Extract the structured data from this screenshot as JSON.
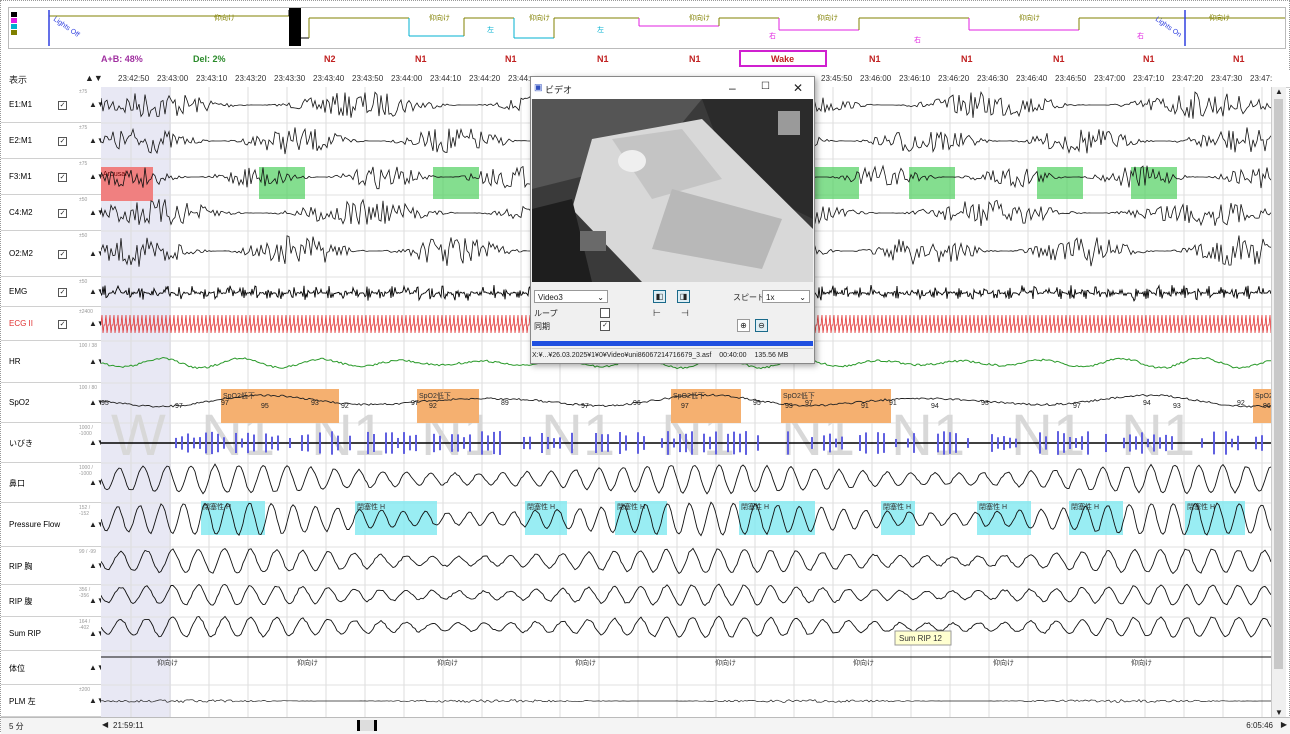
{
  "hypnogram": {
    "legend_colors": [
      "#000000",
      "#e020e0",
      "#00b0d0",
      "#808000"
    ],
    "labels_upper": [
      "仰向け",
      "仰向け",
      "仰向け",
      "仰向け",
      "仰向け",
      "仰向け",
      "仰向け"
    ],
    "lights_off": "Lights Off",
    "lights_on": "Lights On",
    "labels_side": [
      "左",
      "左",
      "右",
      "右",
      "右"
    ]
  },
  "stage_bar": {
    "ab": "A+B: 48%",
    "del": "Del: 2%",
    "stages": [
      "N2",
      "N1",
      "N1",
      "N1",
      "N1",
      "Wake",
      "N1",
      "N1",
      "N1",
      "N1",
      "N1"
    ]
  },
  "time_bar": {
    "display_label": "表示",
    "ticks": [
      "23:42:50",
      "23:43:00",
      "23:43:10",
      "23:43:20",
      "23:43:30",
      "23:43:40",
      "23:43:50",
      "23:44:00",
      "23:44:10",
      "23:44:20",
      "23:44:",
      "23:45:50",
      "23:46:00",
      "23:46:10",
      "23:46:20",
      "23:46:30",
      "23:46:40",
      "23:46:50",
      "23:47:00",
      "23:47:10",
      "23:47:20",
      "23:47:30",
      "23:47:"
    ]
  },
  "channels": [
    {
      "name": "E1:M1",
      "checked": true,
      "mini": "±75",
      "color": "#000000"
    },
    {
      "name": "E2:M1",
      "checked": true,
      "mini": "±75",
      "color": "#000000"
    },
    {
      "name": "F3:M1",
      "checked": true,
      "mini": "±75",
      "color": "#000000"
    },
    {
      "name": "C4:M2",
      "checked": true,
      "mini": "±50",
      "color": "#000000"
    },
    {
      "name": "O2:M2",
      "checked": true,
      "mini": "±50",
      "color": "#000000"
    },
    {
      "name": "EMG",
      "checked": true,
      "mini": "±50",
      "color": "#000000"
    },
    {
      "name": "ECG II",
      "checked": true,
      "mini": "±2400",
      "color": "#e03030"
    },
    {
      "name": "HR",
      "checked": false,
      "mini": "100 / 38",
      "color": "#000000"
    },
    {
      "name": "SpO2",
      "checked": false,
      "mini": "100 / 80",
      "color": "#000000"
    },
    {
      "name": "いびき",
      "checked": false,
      "mini": "1000 / -1000",
      "color": "#000000"
    },
    {
      "name": "鼻口",
      "checked": false,
      "mini": "1000 / -1000",
      "color": "#000000"
    },
    {
      "name": "Pressure Flow",
      "checked": false,
      "mini": "152 / -152",
      "color": "#000000"
    },
    {
      "name": "RIP 胸",
      "checked": false,
      "mini": "99 / -99",
      "color": "#000000"
    },
    {
      "name": "RIP 腹",
      "checked": false,
      "mini": "356 / -356",
      "color": "#000000"
    },
    {
      "name": "Sum RIP",
      "checked": false,
      "mini": "164 / -402",
      "color": "#000000"
    },
    {
      "name": "体位",
      "checked": false,
      "mini": "",
      "color": "#000000"
    },
    {
      "name": "PLM 左",
      "checked": false,
      "mini": "±200",
      "color": "#000000"
    }
  ],
  "events": {
    "arousal": "Arousal",
    "spo2_drop": "SpO2低下",
    "obstructive": "閉塞性 H",
    "sum_rip_tag": "Sum RIP  12",
    "position": "仰向け",
    "spo2_values": [
      "95",
      "97",
      "97",
      "95",
      "93",
      "92",
      "97",
      "92",
      "89",
      "97",
      "96",
      "97",
      "95",
      "93",
      "97",
      "91",
      "91",
      "94",
      "93",
      "97",
      "94",
      "93",
      "92",
      "96"
    ],
    "bg_stage_letters": [
      "W",
      "N1",
      "N1",
      "N1",
      "N1",
      "N1",
      "N1",
      "N1",
      "N1",
      "N1"
    ]
  },
  "video_window": {
    "title": "ビデオ",
    "source": "Video3",
    "speed_label": "スピード",
    "speed_value": "1x",
    "loop_label": "ループ",
    "sync_label": "同期",
    "loop_checked": false,
    "sync_checked": true,
    "status_path": "X:¥...¥26.03.2025¥1¥0¥Video¥uni86067214716679_3.asf",
    "status_time": "00:40:00",
    "status_size": "135.56 MB"
  },
  "bottom_bar": {
    "zoom": "5 分",
    "start": "21:59:11",
    "end": "6:05:46"
  },
  "colors": {
    "arousal_fill": "#f08080",
    "spindle_fill": "#50d060",
    "spo2_fill": "#f5b070",
    "apnea_fill": "#80e8f0",
    "snore_bar": "#6060e0",
    "hr_line": "#2a9a2a",
    "ecg": "#e02020",
    "wake_box": "#d020d0",
    "progress": "#1f4fe0"
  }
}
